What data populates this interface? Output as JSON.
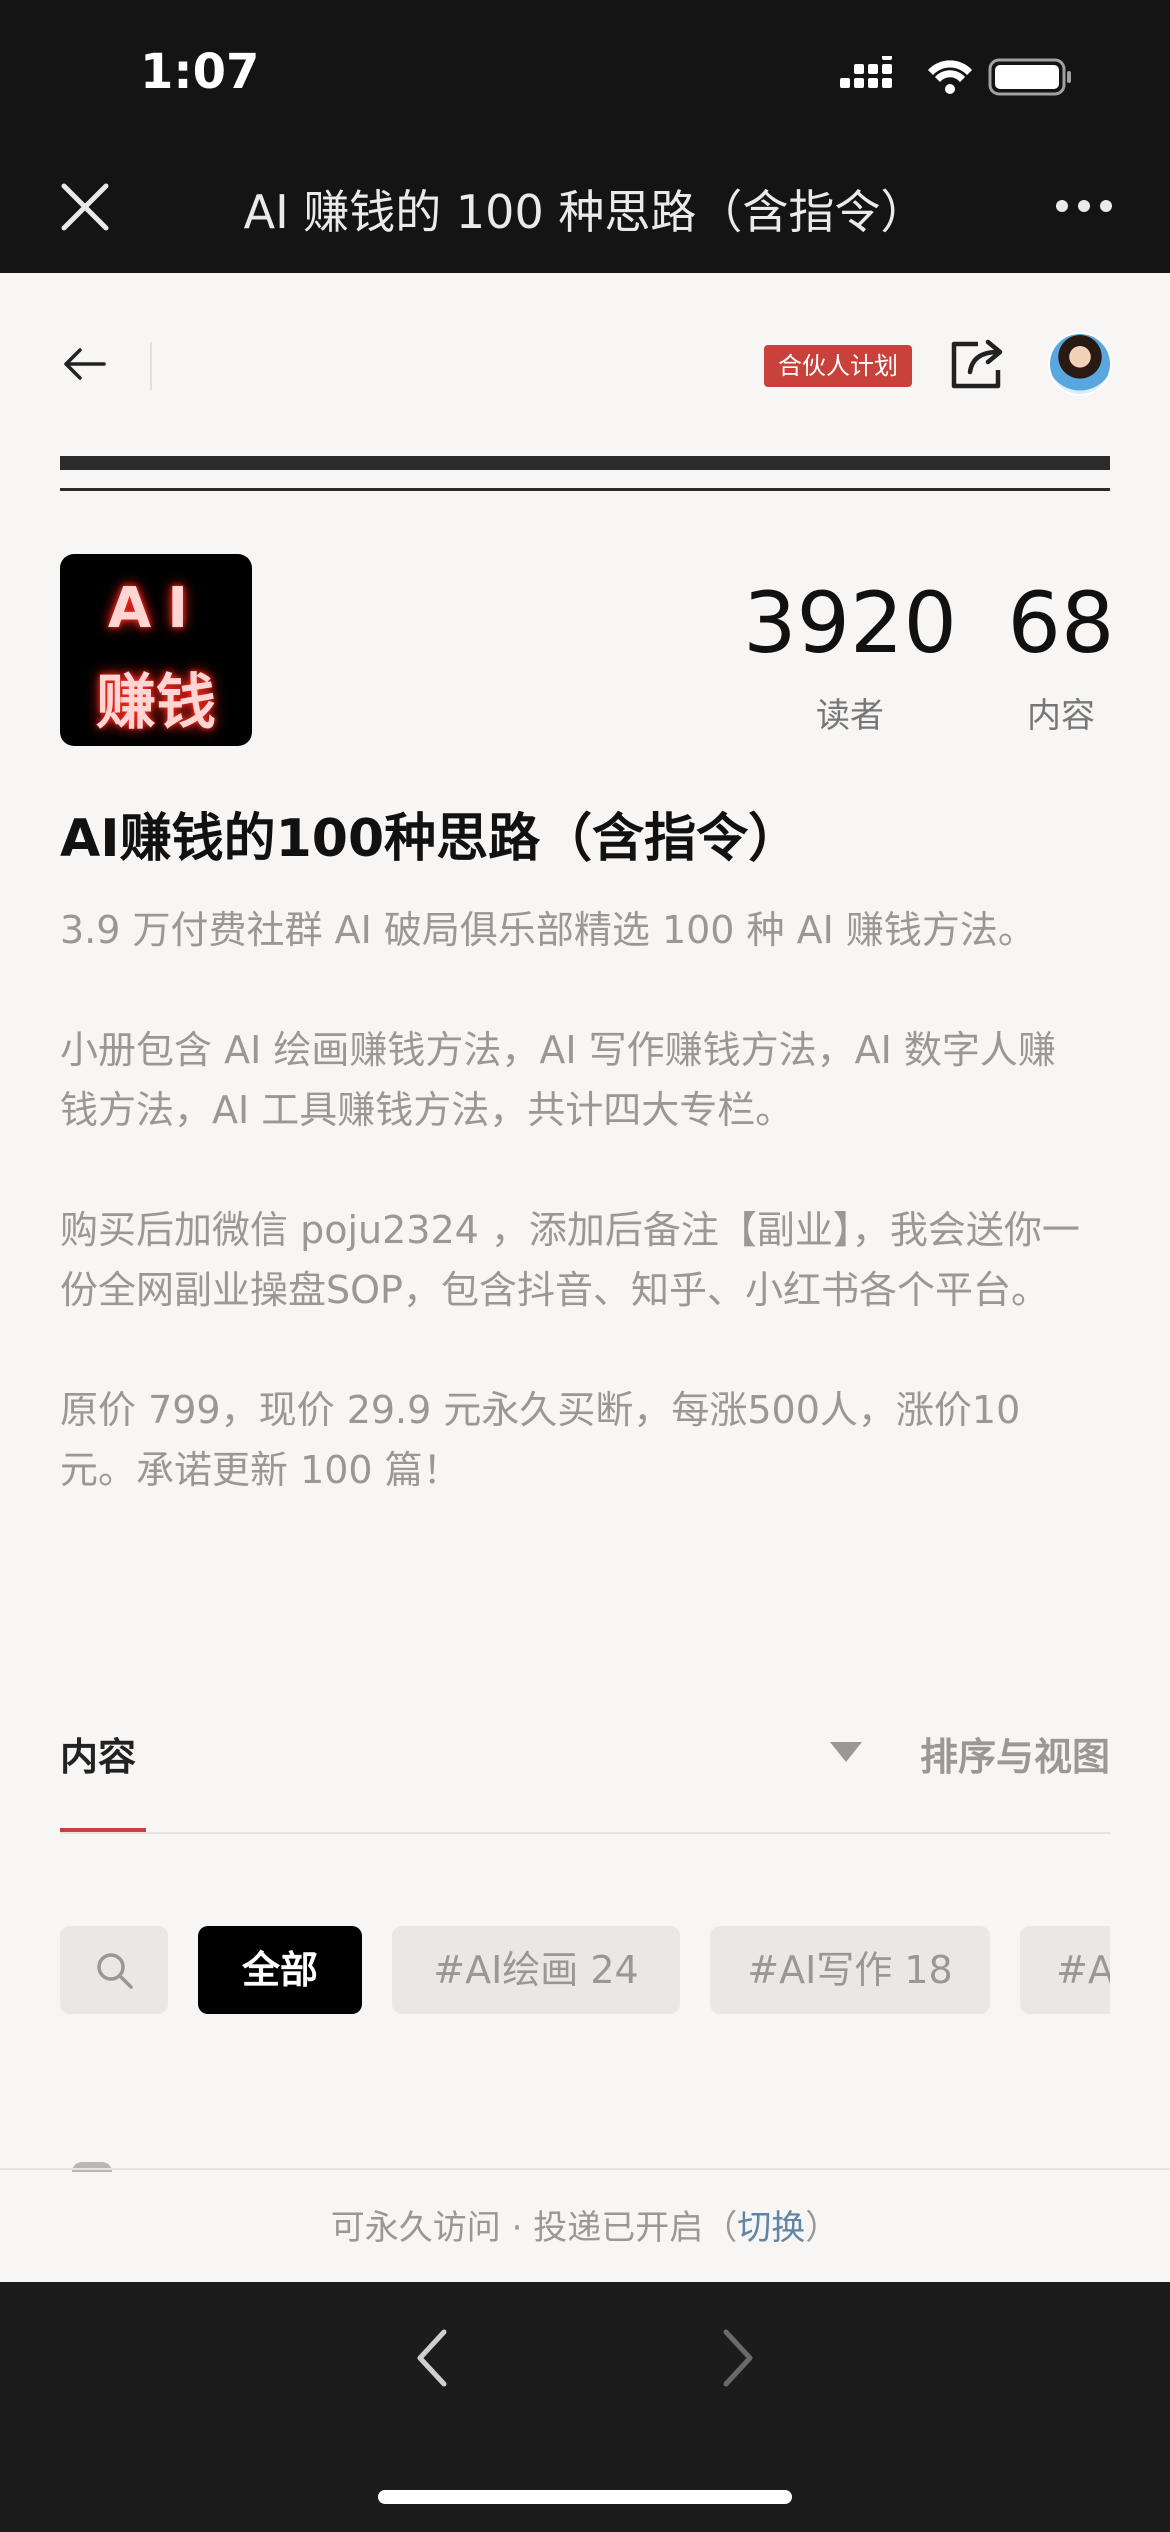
{
  "status_bar": {
    "time": "1:07"
  },
  "wechat_bar": {
    "title": "AI 赚钱的 100 种思路（含指令）"
  },
  "toolbar": {
    "partner_badge": "合伙人计划"
  },
  "logo": {
    "line1": "AI",
    "line2": "赚钱"
  },
  "stats": {
    "readers": {
      "value": "3920",
      "label": "读者"
    },
    "contents": {
      "value": "68",
      "label": "内容"
    }
  },
  "booklet": {
    "title": "AI赚钱的100种思路（含指令）",
    "description": [
      "3.9 万付费社群 AI 破局俱乐部精选 100 种 AI 赚钱方法。",
      "小册包含 AI 绘画赚钱方法，AI 写作赚钱方法，AI 数字人赚钱方法，AI 工具赚钱方法，共计四大专栏。",
      "购买后加微信 poju2324 ，添加后备注【副业】，我会送你一份全网副业操盘SOP，包含抖音、知乎、小红书各个平台。",
      "原价 799，现价 29.9 元永久买断，每涨500人，涨价10元。承诺更新 100 篇！"
    ]
  },
  "content_section": {
    "tab": "内容",
    "sort": "排序与视图"
  },
  "chips": {
    "all": "全部",
    "draw": "#AI绘画 24",
    "write": "#AI写作 18",
    "more": "#A"
  },
  "bottom_status": {
    "text": "可永久访问 · 投递已开启（",
    "link": "切换",
    "close": "）"
  },
  "colors": {
    "accent": "#c9413b",
    "link": "#5f86a6",
    "bar": "#141414"
  },
  "icons": [
    "close-icon",
    "more-icon",
    "back-arrow-icon",
    "share-icon",
    "search-icon",
    "caret-down-icon",
    "chevron-left-icon",
    "chevron-right-icon"
  ]
}
